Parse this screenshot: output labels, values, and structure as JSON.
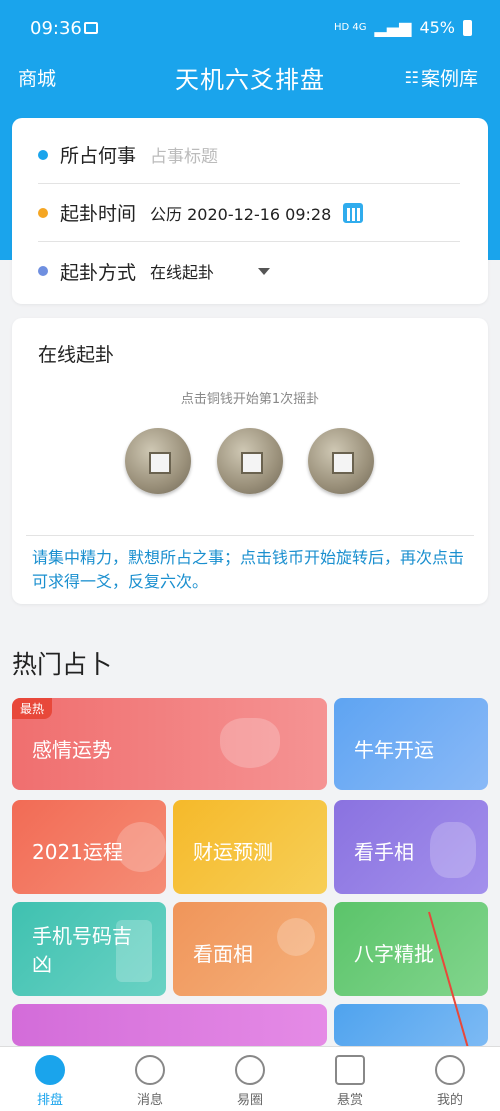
{
  "status": {
    "time": "09:36",
    "battery": "45%",
    "network": "HD 4G"
  },
  "header": {
    "left": "商城",
    "title": "天机六爻排盘",
    "right": "案例库"
  },
  "form": {
    "row1": {
      "label": "所占何事",
      "placeholder": "占事标题"
    },
    "row2": {
      "label": "起卦时间",
      "value": "公历 2020-12-16 09:28"
    },
    "row3": {
      "label": "起卦方式",
      "value": "在线起卦"
    }
  },
  "coins": {
    "title": "在线起卦",
    "tip": "点击铜钱开始第1次摇卦",
    "note": "请集中精力，默想所占之事；点击钱币开始旋转后，再次点击可求得一爻，反复六次。"
  },
  "hot": {
    "title": "热门占卜",
    "badge": "最热",
    "tiles": [
      "感情运势",
      "牛年开运",
      "2021运程",
      "财运预测",
      "看手相",
      "手机号码吉凶",
      "看面相",
      "八字精批"
    ]
  },
  "nav": [
    "排盘",
    "消息",
    "易圈",
    "悬赏",
    "我的"
  ],
  "colors": {
    "brand": "#1aa4ec",
    "dot1": "#1aa4ec",
    "dot2": "#f5a623",
    "dot3": "#6f8fe0"
  }
}
